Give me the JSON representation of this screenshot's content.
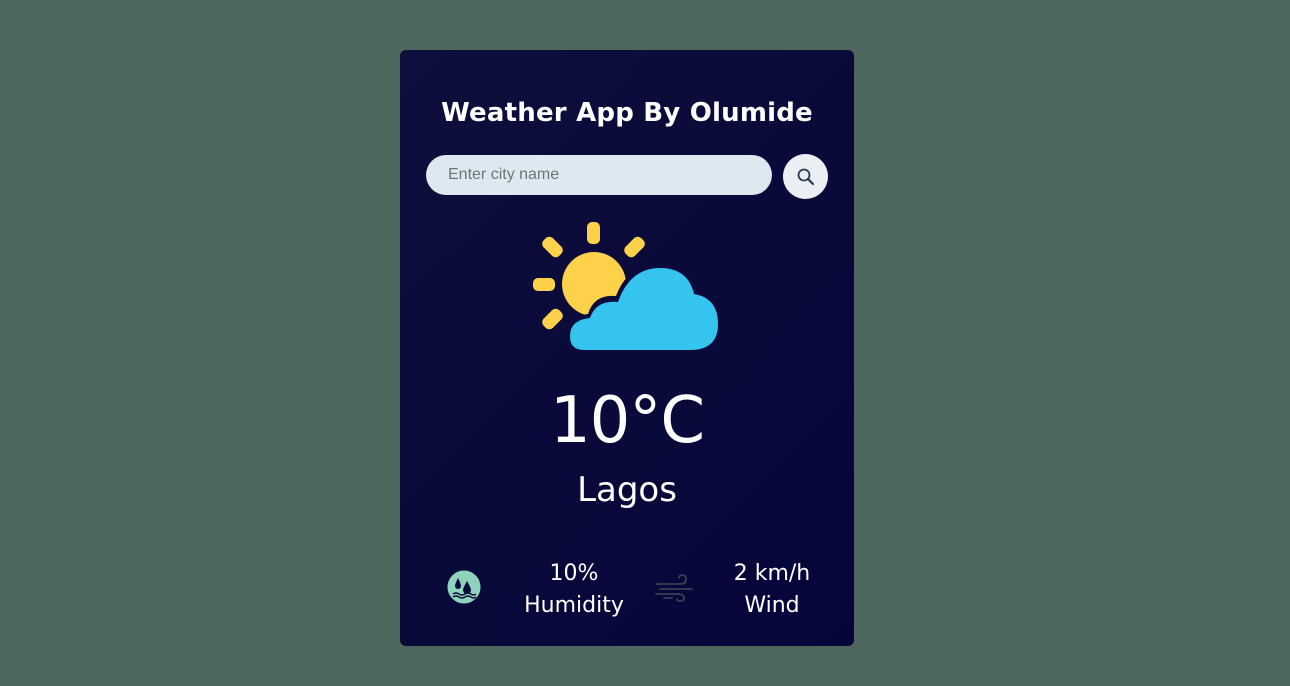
{
  "app": {
    "title": "Weather App By Olumide"
  },
  "search": {
    "placeholder": "Enter city name",
    "value": "",
    "button_icon": "search-icon"
  },
  "weather": {
    "condition_icon": "partly-cloudy-icon",
    "temperature": "10°C",
    "city": "Lagos"
  },
  "details": {
    "humidity": {
      "icon": "humidity-icon",
      "value": "10%",
      "label": "Humidity"
    },
    "wind": {
      "icon": "wind-icon",
      "value": "2 km/h",
      "label": "Wind"
    }
  },
  "colors": {
    "page_background": "#4d675c",
    "card_background": "#0a0a3a",
    "input_background": "#dde9f0",
    "sun": "#fdd14a",
    "cloud": "#35c4ee",
    "humidity_icon": "#8fd3bc"
  }
}
